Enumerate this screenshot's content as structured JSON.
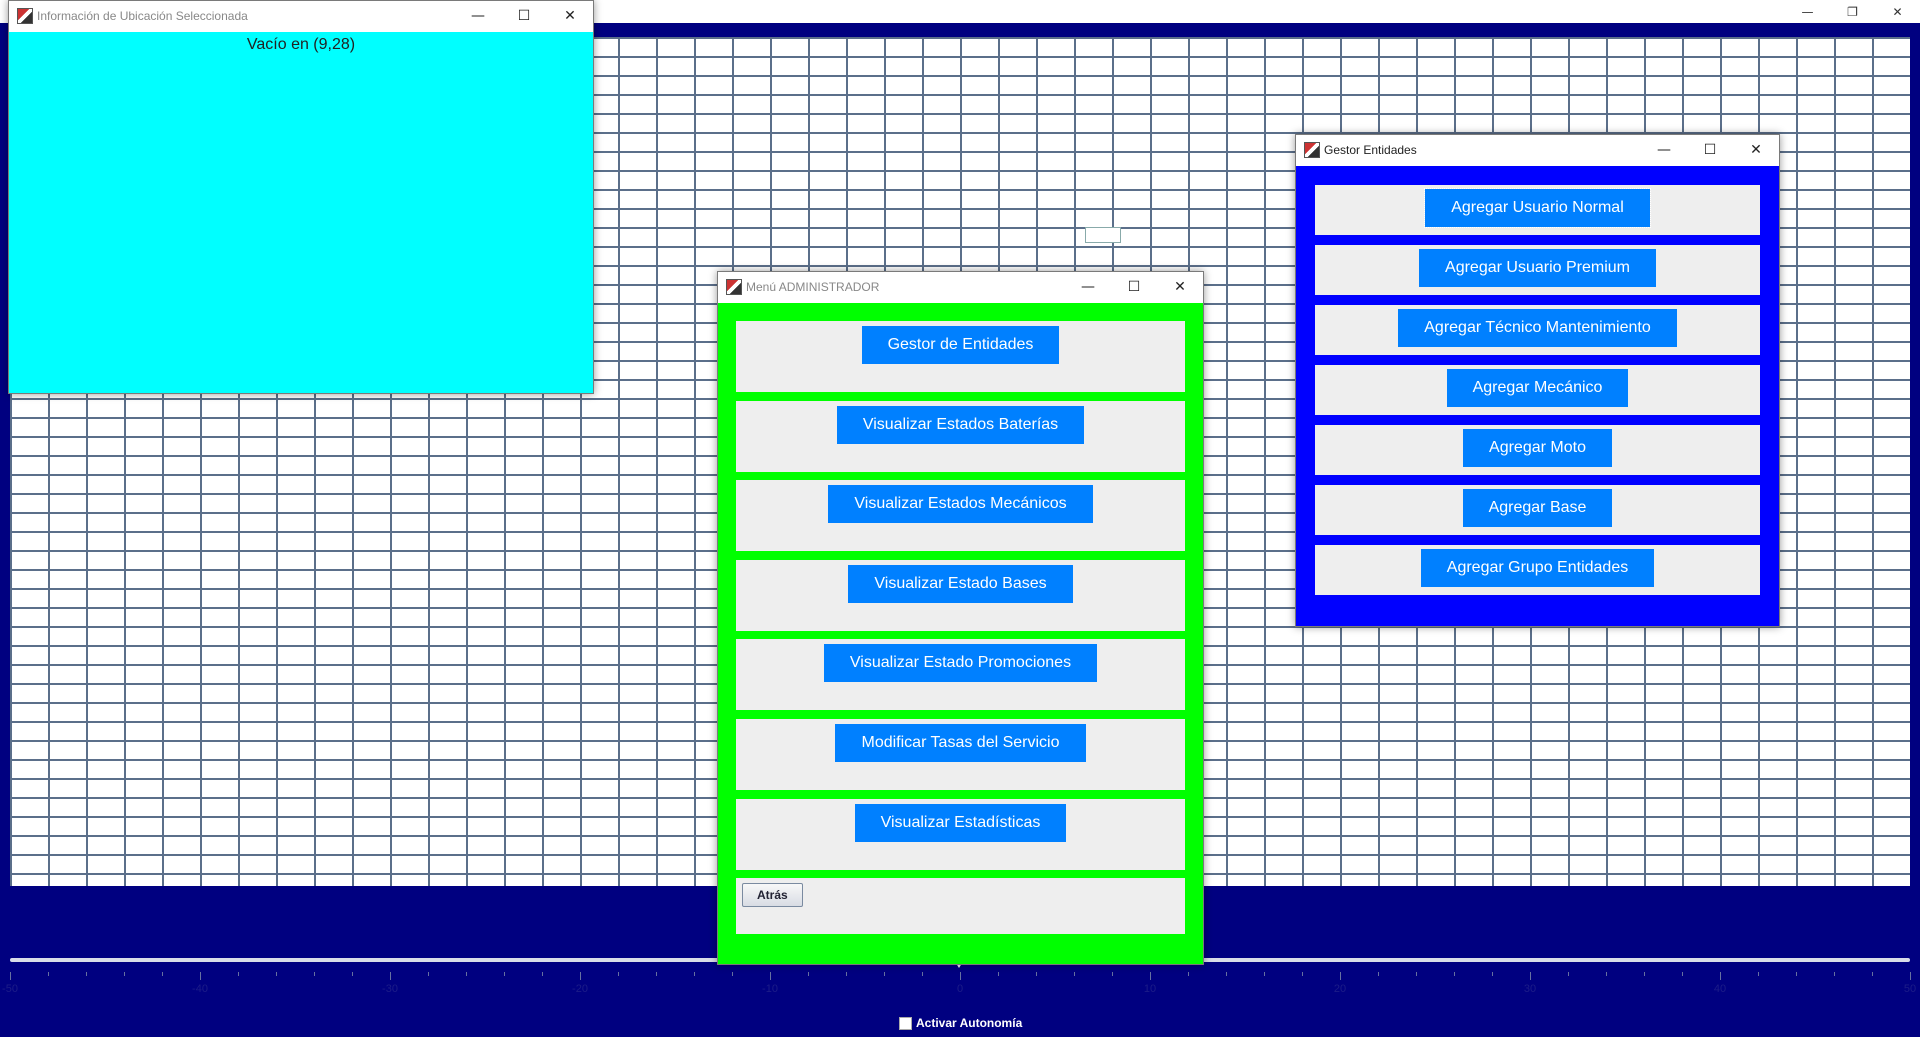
{
  "main_window": {
    "controls": {
      "minimize": "—",
      "restore": "❐",
      "close": "✕"
    }
  },
  "info_window": {
    "title": "Información de Ubicación Seleccionada",
    "content": "Vacío en (9,28)",
    "background": "#00ffff",
    "controls": {
      "minimize": "—",
      "maximize": "☐",
      "close": "✕"
    }
  },
  "menu_window": {
    "title": "Menú ADMINISTRADOR",
    "background": "#00ff00",
    "controls": {
      "minimize": "—",
      "maximize": "☐",
      "close": "✕"
    },
    "buttons": [
      "Gestor de Entidades",
      "Visualizar Estados Baterías",
      "Visualizar Estados Mecánicos",
      "Visualizar Estado Bases",
      "Visualizar Estado Promociones",
      "Modificar Tasas del Servicio",
      "Visualizar Estadísticas"
    ],
    "back_label": "Atrás"
  },
  "gestor_window": {
    "title": "Gestor Entidades",
    "background": "#0000ff",
    "controls": {
      "minimize": "—",
      "maximize": "☐",
      "close": "✕"
    },
    "buttons": [
      "Agregar Usuario Normal",
      "Agregar Usuario Premium",
      "Agregar Técnico Mantenimiento",
      "Agregar Mecánico",
      "Agregar Moto",
      "Agregar Base",
      "Agregar Grupo Entidades"
    ]
  },
  "slider": {
    "min": -50,
    "max": 50,
    "value": 0,
    "labels": [
      "-50",
      "-40",
      "-30",
      "-20",
      "-10",
      "0",
      "10",
      "20",
      "30",
      "40",
      "50"
    ]
  },
  "autonomy": {
    "label": "Activar Autonomía",
    "checked": false
  },
  "colors": {
    "background": "#000080",
    "button": "#0080ff",
    "panel": "#eeeeee"
  }
}
